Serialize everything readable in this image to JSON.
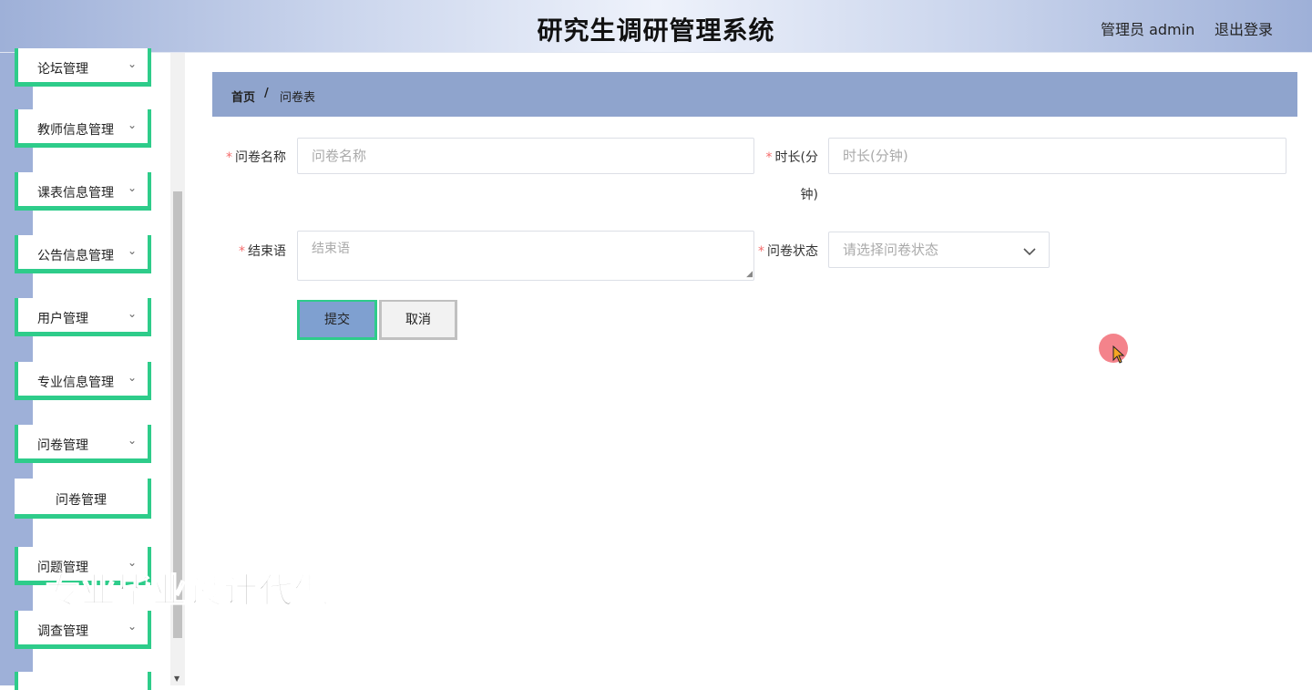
{
  "header": {
    "title": "研究生调研管理系统",
    "user_label": "管理员 admin",
    "logout_label": "退出登录"
  },
  "sidebar": {
    "items": [
      {
        "label": "论坛管理"
      },
      {
        "label": "教师信息管理"
      },
      {
        "label": "课表信息管理"
      },
      {
        "label": "公告信息管理"
      },
      {
        "label": "用户管理"
      },
      {
        "label": "专业信息管理"
      },
      {
        "label": "问卷管理"
      },
      {
        "label": "问卷管理"
      },
      {
        "label": "问题管理"
      },
      {
        "label": "调查管理"
      }
    ]
  },
  "watermark": "专业毕业设计代做",
  "breadcrumb": {
    "home": "首页",
    "separator": "/",
    "current": "问卷表"
  },
  "form": {
    "name": {
      "label": "问卷名称",
      "placeholder": "问卷名称",
      "value": ""
    },
    "duration": {
      "label_line1": "时长(分",
      "label_line2": "钟)",
      "placeholder": "时长(分钟)",
      "value": ""
    },
    "closing": {
      "label": "结束语",
      "placeholder": "结束语",
      "value": ""
    },
    "status": {
      "label": "问卷状态",
      "placeholder": "请选择问卷状态",
      "value": ""
    },
    "required_mark": "*"
  },
  "buttons": {
    "submit": "提交",
    "cancel": "取消"
  },
  "colors": {
    "accent_green": "#2ecc8a",
    "breadcrumb_bg": "#8fa4cd",
    "submit_bg": "#7fa0d0",
    "required": "#f56c6c"
  }
}
